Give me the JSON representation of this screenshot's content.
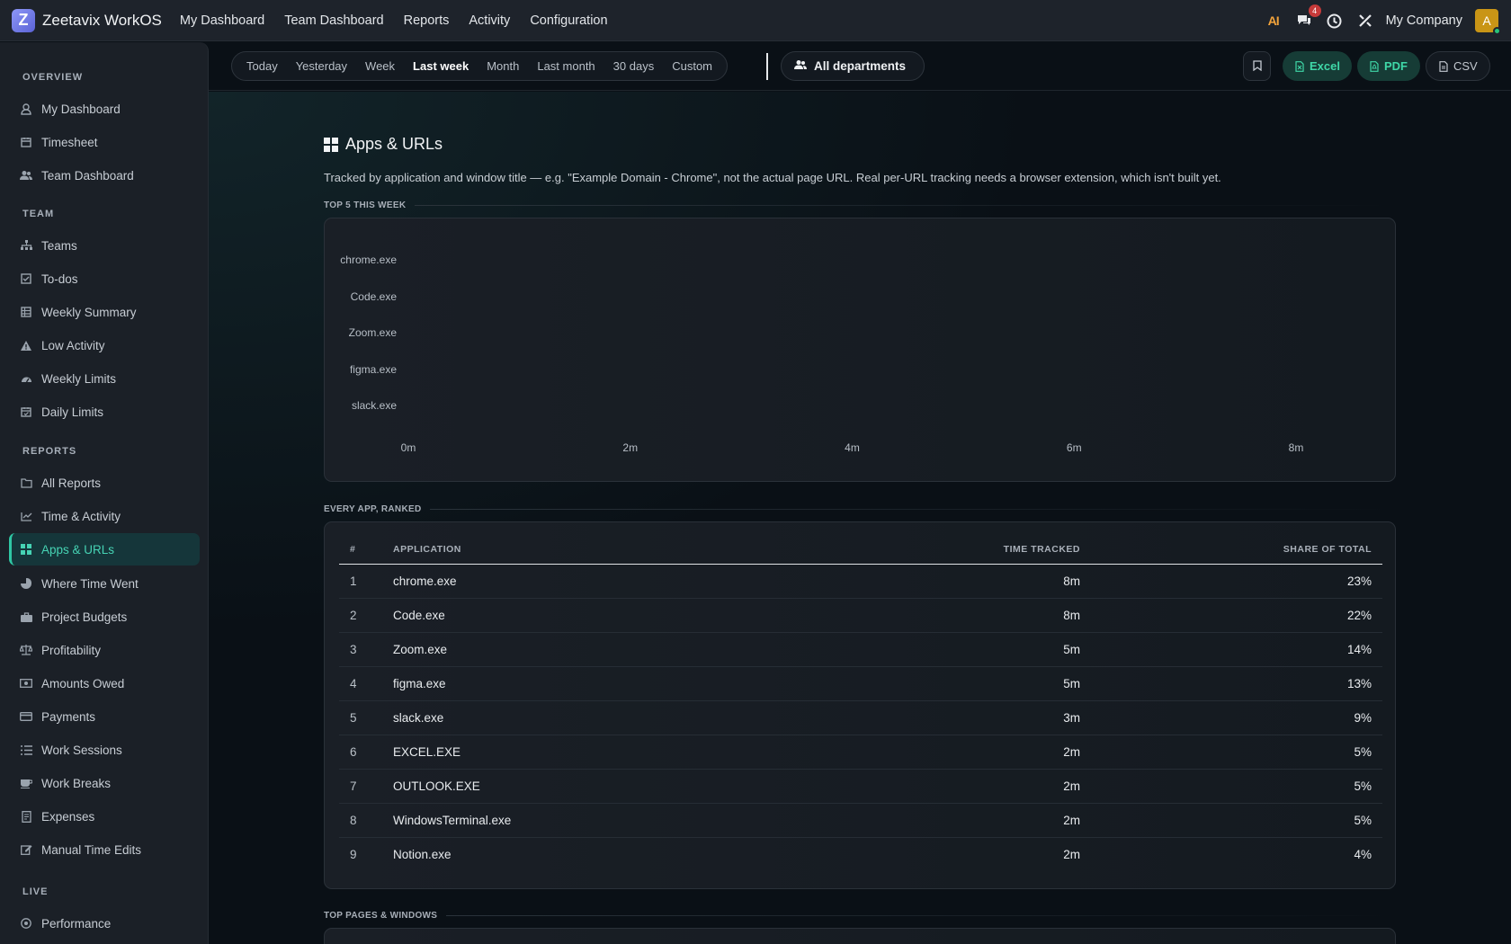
{
  "topbar": {
    "logo_letter": "Z",
    "app_title": "Zeetavix WorkOS",
    "nav": [
      "My Dashboard",
      "Team Dashboard",
      "Reports",
      "Activity",
      "Configuration"
    ],
    "ai_label": "AI",
    "messages_badge": "4",
    "company": "My Company",
    "avatar_letter": "A"
  },
  "sidebar": {
    "sections": [
      {
        "title": "OVERVIEW",
        "items": [
          {
            "label": "My Dashboard",
            "icon": "user-icon"
          },
          {
            "label": "Timesheet",
            "icon": "calendar-icon"
          },
          {
            "label": "Team Dashboard",
            "icon": "users-icon"
          }
        ]
      },
      {
        "title": "TEAM",
        "items": [
          {
            "label": "Teams",
            "icon": "sitemap-icon"
          },
          {
            "label": "To-dos",
            "icon": "checkbox-icon"
          },
          {
            "label": "Weekly Summary",
            "icon": "table-icon"
          },
          {
            "label": "Low Activity",
            "icon": "warning-icon"
          },
          {
            "label": "Weekly Limits",
            "icon": "gauge-icon"
          },
          {
            "label": "Daily Limits",
            "icon": "calendar-check-icon"
          }
        ]
      },
      {
        "title": "REPORTS",
        "items": [
          {
            "label": "All Reports",
            "icon": "folder-icon"
          },
          {
            "label": "Time & Activity",
            "icon": "line-chart-icon"
          },
          {
            "label": "Apps & URLs",
            "icon": "grid-icon"
          },
          {
            "label": "Where Time Went",
            "icon": "pie-chart-icon"
          },
          {
            "label": "Project Budgets",
            "icon": "briefcase-icon"
          },
          {
            "label": "Profitability",
            "icon": "scale-icon"
          },
          {
            "label": "Amounts Owed",
            "icon": "money-icon"
          },
          {
            "label": "Payments",
            "icon": "credit-card-icon"
          },
          {
            "label": "Work Sessions",
            "icon": "list-icon"
          },
          {
            "label": "Work Breaks",
            "icon": "coffee-icon"
          },
          {
            "label": "Expenses",
            "icon": "receipt-icon"
          },
          {
            "label": "Manual Time Edits",
            "icon": "edit-icon"
          }
        ]
      },
      {
        "title": "LIVE",
        "items": [
          {
            "label": "Performance",
            "icon": "target-icon"
          }
        ]
      }
    ],
    "active": "Apps & URLs"
  },
  "filters": {
    "ranges": [
      "Today",
      "Yesterday",
      "Week",
      "Last week",
      "Month",
      "Last month",
      "30 days",
      "Custom"
    ],
    "selected_range": "Last week",
    "department": "All departments",
    "export": {
      "excel": "Excel",
      "pdf": "PDF",
      "csv": "CSV"
    }
  },
  "page": {
    "title": "Apps & URLs",
    "description": "Tracked by application and window title — e.g. \"Example Domain - Chrome\", not the actual page URL. Real per-URL tracking needs a browser extension, which isn't built yet.",
    "section_top5": "TOP 5 THIS WEEK",
    "section_ranked": "EVERY APP, RANKED",
    "section_pages": "TOP PAGES & WINDOWS"
  },
  "chart_data": {
    "type": "bar",
    "orientation": "horizontal",
    "categories": [
      "chrome.exe",
      "Code.exe",
      "Zoom.exe",
      "figma.exe",
      "slack.exe"
    ],
    "values": [
      0,
      0,
      0,
      0,
      0
    ],
    "x_ticks": [
      "0m",
      "2m",
      "4m",
      "6m",
      "8m"
    ],
    "xlim": [
      0,
      8
    ]
  },
  "table": {
    "headers": {
      "num": "#",
      "app": "APPLICATION",
      "time": "TIME TRACKED",
      "share": "SHARE OF TOTAL"
    },
    "rows": [
      {
        "num": "1",
        "app": "chrome.exe",
        "time": "8m",
        "share": "23%"
      },
      {
        "num": "2",
        "app": "Code.exe",
        "time": "8m",
        "share": "22%"
      },
      {
        "num": "3",
        "app": "Zoom.exe",
        "time": "5m",
        "share": "14%"
      },
      {
        "num": "4",
        "app": "figma.exe",
        "time": "5m",
        "share": "13%"
      },
      {
        "num": "5",
        "app": "slack.exe",
        "time": "3m",
        "share": "9%"
      },
      {
        "num": "6",
        "app": "EXCEL.EXE",
        "time": "2m",
        "share": "5%"
      },
      {
        "num": "7",
        "app": "OUTLOOK.EXE",
        "time": "2m",
        "share": "5%"
      },
      {
        "num": "8",
        "app": "WindowsTerminal.exe",
        "time": "2m",
        "share": "5%"
      },
      {
        "num": "9",
        "app": "Notion.exe",
        "time": "2m",
        "share": "4%"
      }
    ]
  }
}
